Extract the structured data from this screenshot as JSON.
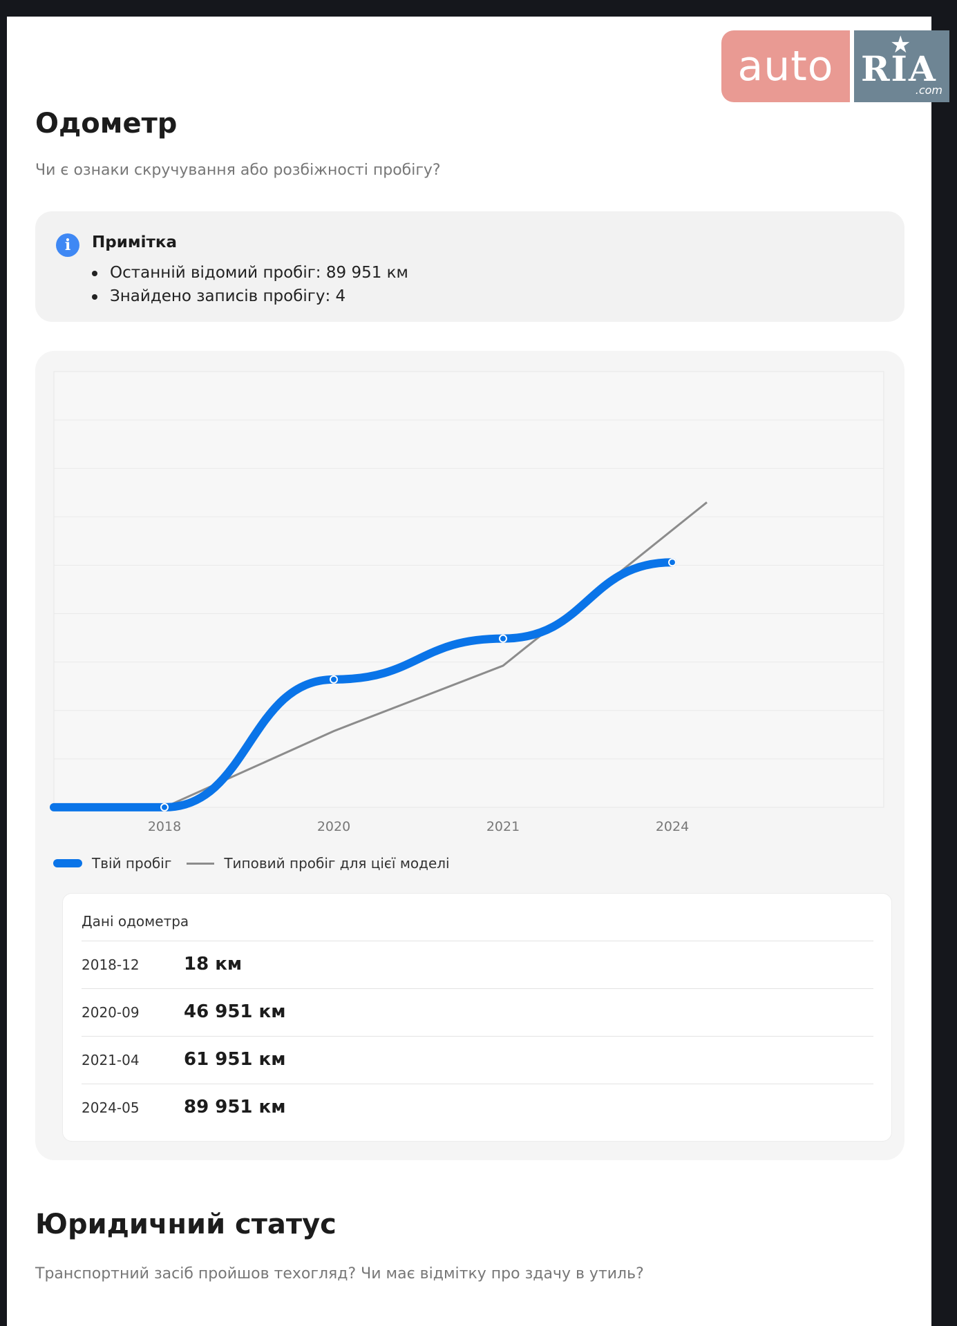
{
  "logo": {
    "auto": "auto",
    "ria": "RIA",
    "com": ".com"
  },
  "odometer": {
    "title": "Одометр",
    "subtitle": "Чи є ознаки скручування або розбіжності пробігу?"
  },
  "note": {
    "icon": "info-icon",
    "title": "Примітка",
    "items": [
      "Останній відомий пробіг: 89 951 км",
      "Знайдено записів пробігу: 4"
    ]
  },
  "chart_data": {
    "type": "line",
    "x_ticks": [
      "2018",
      "2020",
      "2021",
      "2024"
    ],
    "series": [
      {
        "name": "Твій пробіг",
        "color": "#0a74e8",
        "x": [
          "2018-12",
          "2020-09",
          "2021-04",
          "2024-05"
        ],
        "values": [
          18,
          46951,
          61951,
          89951
        ]
      },
      {
        "name": "Типовий пробіг для цієї моделі",
        "color": "#8c8c8c",
        "values": [
          0,
          28000,
          52000,
          112000
        ]
      }
    ],
    "grid": true,
    "legend": "bottom-left"
  },
  "legend": {
    "yours": "Твій пробіг",
    "typical": "Типовий пробіг для цієї моделі"
  },
  "table": {
    "title": "Дані одометра",
    "rows": [
      {
        "date": "2018-12",
        "value": "18 км"
      },
      {
        "date": "2020-09",
        "value": "46 951 км"
      },
      {
        "date": "2021-04",
        "value": "61 951 км"
      },
      {
        "date": "2024-05",
        "value": "89 951 км"
      }
    ]
  },
  "legal": {
    "title": "Юридичний статус",
    "subtitle": "Транспортний засіб пройшов техогляд? Чи має відмітку про здачу в утиль?"
  }
}
